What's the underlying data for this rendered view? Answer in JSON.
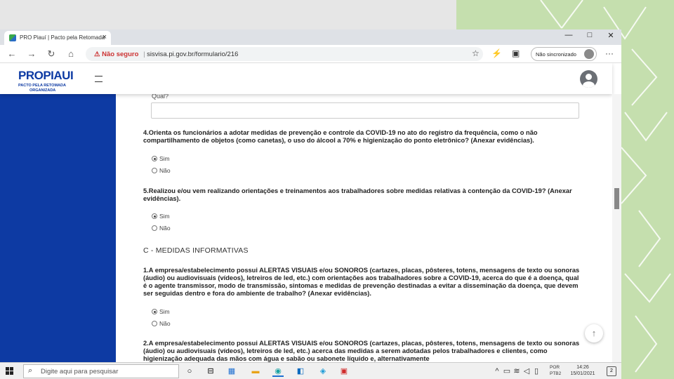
{
  "browser": {
    "tab_title": "PRO Piauí | Pacto pela Retomada",
    "tab_close": "×",
    "window_controls": {
      "minimize": "—",
      "maximize": "□",
      "close": "✕"
    },
    "nav": {
      "back": "←",
      "forward": "→",
      "reload": "↻",
      "home": "⌂"
    },
    "url_warning": "⚠ Não seguro",
    "url": "sisvisa.pi.gov.br/formulario/216",
    "sync_label": "Não sincronizado",
    "more": "···"
  },
  "header": {
    "brand": "PROPIAUI",
    "brand_sub_1": "PACTO PELA RETOMADA",
    "brand_sub_2": "ORGANIZADA"
  },
  "form": {
    "qual_label": "Qual?",
    "q4": "4.Orienta os funcionários a adotar medidas de prevenção e controle da COVID-19 no ato do registro da frequência, como o não compartilhamento de objetos (como canetas), o uso do álcool a 70% e higienização do ponto eletrônico? (Anexar evidências).",
    "q4_yes": "Sim",
    "q4_no": "Não",
    "q5": "5.Realizou e/ou vem realizando orientações e treinamentos aos trabalhadores sobre medidas relativas à contenção da COVID-19? (Anexar evidências).",
    "q5_yes": "Sim",
    "q5_no": "Não",
    "section_c": "C - MEDIDAS INFORMATIVAS",
    "c1": "1.A empresa/estabelecimento possui ALERTAS VISUAIS e/ou SONOROS (cartazes, placas, pôsteres, totens, mensagens de texto ou sonoras (áudio) ou audiovisuais (vídeos), letreiros de led, etc.) com orientações aos trabalhadores sobre a COVID-19, acerca do que é a doença, qual é o agente transmissor, modo de transmissão, sintomas e medidas de prevenção destinadas a evitar a disseminação da doença, que devem ser seguidas dentro e fora do ambiente de trabalho? (Anexar evidências).",
    "c1_yes": "Sim",
    "c1_no": "Não",
    "c2": "2.A empresa/estabelecimento possui ALERTAS VISUAIS e/ou SONOROS (cartazes, placas, pôsteres, totens, mensagens de texto ou sonoras (áudio) ou audiovisuais (vídeos), letreiros de led, etc.) acerca das medidas a serem adotadas pelos trabalhadores e clientes, como higienização adequada das mãos com água e sabão ou sabonete líquido e, alternativamente"
  },
  "taskbar": {
    "search_placeholder": "Digite aqui para pesquisar",
    "lang_1": "POR",
    "lang_2": "PTB2",
    "time": "14:26",
    "date": "15/01/2021",
    "notifications": "2"
  }
}
